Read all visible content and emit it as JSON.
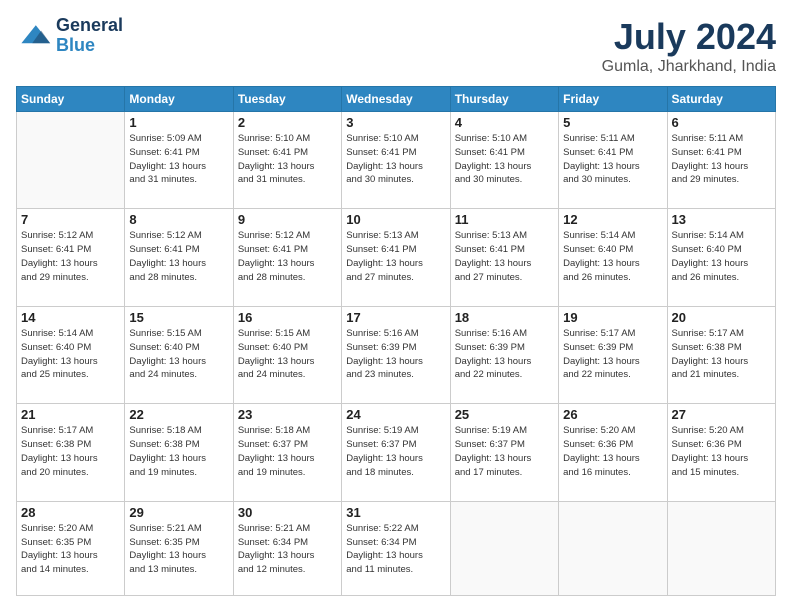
{
  "logo": {
    "line1": "General",
    "line2": "Blue"
  },
  "title": "July 2024",
  "subtitle": "Gumla, Jharkhand, India",
  "weekdays": [
    "Sunday",
    "Monday",
    "Tuesday",
    "Wednesday",
    "Thursday",
    "Friday",
    "Saturday"
  ],
  "weeks": [
    [
      {
        "day": "",
        "empty": true
      },
      {
        "day": "1",
        "sunrise": "5:09 AM",
        "sunset": "6:41 PM",
        "daylight": "13 hours and 31 minutes."
      },
      {
        "day": "2",
        "sunrise": "5:10 AM",
        "sunset": "6:41 PM",
        "daylight": "13 hours and 31 minutes."
      },
      {
        "day": "3",
        "sunrise": "5:10 AM",
        "sunset": "6:41 PM",
        "daylight": "13 hours and 30 minutes."
      },
      {
        "day": "4",
        "sunrise": "5:10 AM",
        "sunset": "6:41 PM",
        "daylight": "13 hours and 30 minutes."
      },
      {
        "day": "5",
        "sunrise": "5:11 AM",
        "sunset": "6:41 PM",
        "daylight": "13 hours and 30 minutes."
      },
      {
        "day": "6",
        "sunrise": "5:11 AM",
        "sunset": "6:41 PM",
        "daylight": "13 hours and 29 minutes."
      }
    ],
    [
      {
        "day": "7",
        "sunrise": "5:12 AM",
        "sunset": "6:41 PM",
        "daylight": "13 hours and 29 minutes."
      },
      {
        "day": "8",
        "sunrise": "5:12 AM",
        "sunset": "6:41 PM",
        "daylight": "13 hours and 28 minutes."
      },
      {
        "day": "9",
        "sunrise": "5:12 AM",
        "sunset": "6:41 PM",
        "daylight": "13 hours and 28 minutes."
      },
      {
        "day": "10",
        "sunrise": "5:13 AM",
        "sunset": "6:41 PM",
        "daylight": "13 hours and 27 minutes."
      },
      {
        "day": "11",
        "sunrise": "5:13 AM",
        "sunset": "6:41 PM",
        "daylight": "13 hours and 27 minutes."
      },
      {
        "day": "12",
        "sunrise": "5:14 AM",
        "sunset": "6:40 PM",
        "daylight": "13 hours and 26 minutes."
      },
      {
        "day": "13",
        "sunrise": "5:14 AM",
        "sunset": "6:40 PM",
        "daylight": "13 hours and 26 minutes."
      }
    ],
    [
      {
        "day": "14",
        "sunrise": "5:14 AM",
        "sunset": "6:40 PM",
        "daylight": "13 hours and 25 minutes."
      },
      {
        "day": "15",
        "sunrise": "5:15 AM",
        "sunset": "6:40 PM",
        "daylight": "13 hours and 24 minutes."
      },
      {
        "day": "16",
        "sunrise": "5:15 AM",
        "sunset": "6:40 PM",
        "daylight": "13 hours and 24 minutes."
      },
      {
        "day": "17",
        "sunrise": "5:16 AM",
        "sunset": "6:39 PM",
        "daylight": "13 hours and 23 minutes."
      },
      {
        "day": "18",
        "sunrise": "5:16 AM",
        "sunset": "6:39 PM",
        "daylight": "13 hours and 22 minutes."
      },
      {
        "day": "19",
        "sunrise": "5:17 AM",
        "sunset": "6:39 PM",
        "daylight": "13 hours and 22 minutes."
      },
      {
        "day": "20",
        "sunrise": "5:17 AM",
        "sunset": "6:38 PM",
        "daylight": "13 hours and 21 minutes."
      }
    ],
    [
      {
        "day": "21",
        "sunrise": "5:17 AM",
        "sunset": "6:38 PM",
        "daylight": "13 hours and 20 minutes."
      },
      {
        "day": "22",
        "sunrise": "5:18 AM",
        "sunset": "6:38 PM",
        "daylight": "13 hours and 19 minutes."
      },
      {
        "day": "23",
        "sunrise": "5:18 AM",
        "sunset": "6:37 PM",
        "daylight": "13 hours and 19 minutes."
      },
      {
        "day": "24",
        "sunrise": "5:19 AM",
        "sunset": "6:37 PM",
        "daylight": "13 hours and 18 minutes."
      },
      {
        "day": "25",
        "sunrise": "5:19 AM",
        "sunset": "6:37 PM",
        "daylight": "13 hours and 17 minutes."
      },
      {
        "day": "26",
        "sunrise": "5:20 AM",
        "sunset": "6:36 PM",
        "daylight": "13 hours and 16 minutes."
      },
      {
        "day": "27",
        "sunrise": "5:20 AM",
        "sunset": "6:36 PM",
        "daylight": "13 hours and 15 minutes."
      }
    ],
    [
      {
        "day": "28",
        "sunrise": "5:20 AM",
        "sunset": "6:35 PM",
        "daylight": "13 hours and 14 minutes."
      },
      {
        "day": "29",
        "sunrise": "5:21 AM",
        "sunset": "6:35 PM",
        "daylight": "13 hours and 13 minutes."
      },
      {
        "day": "30",
        "sunrise": "5:21 AM",
        "sunset": "6:34 PM",
        "daylight": "13 hours and 12 minutes."
      },
      {
        "day": "31",
        "sunrise": "5:22 AM",
        "sunset": "6:34 PM",
        "daylight": "13 hours and 11 minutes."
      },
      {
        "day": "",
        "empty": true
      },
      {
        "day": "",
        "empty": true
      },
      {
        "day": "",
        "empty": true
      }
    ]
  ]
}
